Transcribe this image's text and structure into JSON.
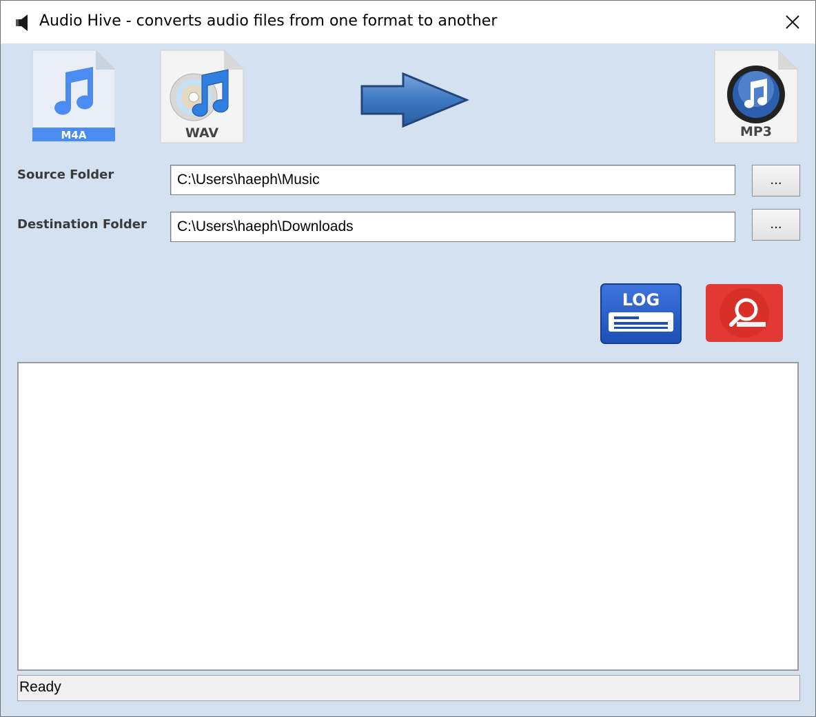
{
  "window": {
    "title": "Audio Hive - converts audio files from one format to another",
    "icon": "speaker-icon",
    "close_icon": "close-icon"
  },
  "formats": {
    "m4a_label": "M4A",
    "wav_label": "WAV",
    "mp3_label": "MP3",
    "arrow_icon": "right-arrow-icon"
  },
  "source": {
    "label": "Source Folder",
    "value": "C:\\Users\\haeph\\Music",
    "browse_label": "..."
  },
  "destination": {
    "label": "Destination Folder",
    "value": "C:\\Users\\haeph\\Downloads",
    "browse_label": "..."
  },
  "actions": {
    "log_label": "LOG",
    "search_icon": "search-icon"
  },
  "status": {
    "text": "Ready"
  },
  "colors": {
    "background": "#d3e1f1",
    "log_blue": "#1f55c6",
    "search_red": "#e13a34"
  }
}
